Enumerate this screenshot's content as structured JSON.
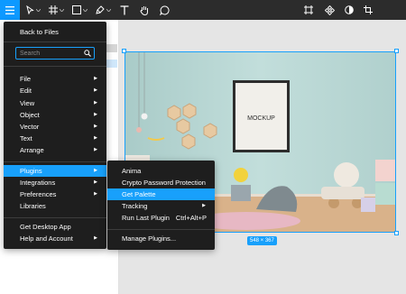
{
  "toolbar": {
    "tools": [
      {
        "icon": "hamburger-menu-icon",
        "active": true
      },
      {
        "icon": "move-arrow-icon"
      },
      {
        "icon": "frame-hash-icon"
      },
      {
        "icon": "rectangle-shape-icon"
      },
      {
        "icon": "pen-icon"
      },
      {
        "icon": "text-tool-icon"
      },
      {
        "icon": "hand-tool-icon"
      },
      {
        "icon": "comment-icon"
      }
    ],
    "right_tools": [
      {
        "icon": "frame-selection-icon"
      },
      {
        "icon": "component-icon"
      },
      {
        "icon": "contrast-mask-icon"
      },
      {
        "icon": "crop-icon"
      }
    ],
    "accent_color": "#0d99ff",
    "background_color": "#2c2c2c"
  },
  "main_menu": {
    "back_to_files": "Back to Files",
    "search_placeholder": "Search",
    "items": [
      {
        "label": "File",
        "submenu": true
      },
      {
        "label": "Edit",
        "submenu": true
      },
      {
        "label": "View",
        "submenu": true
      },
      {
        "label": "Object",
        "submenu": true
      },
      {
        "label": "Vector",
        "submenu": true
      },
      {
        "label": "Text",
        "submenu": true
      },
      {
        "label": "Arrange",
        "submenu": true
      }
    ],
    "items2": [
      {
        "label": "Plugins",
        "submenu": true,
        "active": true
      },
      {
        "label": "Integrations",
        "submenu": true
      },
      {
        "label": "Preferences",
        "submenu": true
      },
      {
        "label": "Libraries",
        "submenu": false
      }
    ],
    "items3": [
      {
        "label": "Get Desktop App",
        "submenu": false
      },
      {
        "label": "Help and Account",
        "submenu": true
      }
    ]
  },
  "plugins_submenu": {
    "items": [
      {
        "label": "Anima"
      },
      {
        "label": "Crypto Password Protection"
      },
      {
        "label": "Get Palette",
        "active": true
      },
      {
        "label": "Tracking",
        "submenu": true
      },
      {
        "label": "Run Last Plugin",
        "shortcut": "Ctrl+Alt+P"
      }
    ],
    "manage": "Manage Plugins..."
  },
  "canvas": {
    "image_text": "MOCKUP",
    "size_label": "548 × 367",
    "selection_color": "#18a0fb"
  }
}
